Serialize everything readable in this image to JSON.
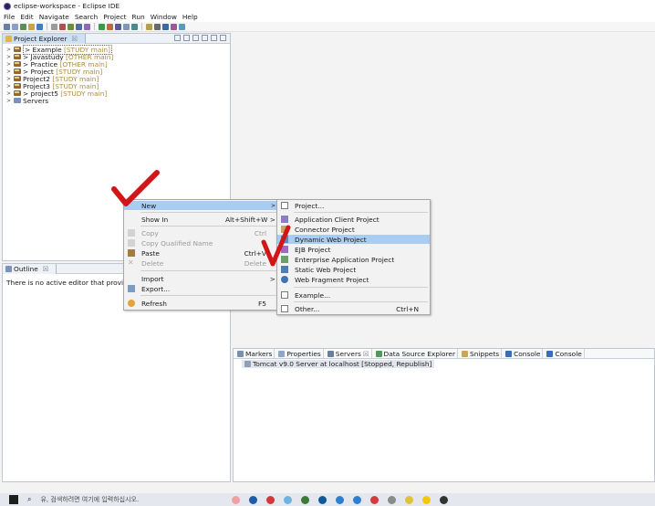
{
  "window": {
    "title": "eclipse-workspace - Eclipse IDE"
  },
  "menubar": [
    "File",
    "Edit",
    "Navigate",
    "Search",
    "Project",
    "Run",
    "Window",
    "Help"
  ],
  "project_explorer": {
    "tab_label": "Project Explorer",
    "close_glyph": "☒",
    "items": [
      {
        "prefix": "> ",
        "name": "Example",
        "tag": "[STUDY main]",
        "icon": "project-icon",
        "selected": true
      },
      {
        "prefix": "> ",
        "name": "Javastudy",
        "tag": "[OTHER main]",
        "icon": "project-icon"
      },
      {
        "prefix": "> ",
        "name": "Practice",
        "tag": "[OTHER main]",
        "icon": "project-icon"
      },
      {
        "prefix": "> ",
        "name": "Project",
        "tag": "[STUDY main]",
        "icon": "project-icon"
      },
      {
        "prefix": "",
        "name": "Project2",
        "tag": "[STUDY main]",
        "icon": "project-icon"
      },
      {
        "prefix": "",
        "name": "Project3",
        "tag": "[STUDY main]",
        "icon": "project-icon"
      },
      {
        "prefix": "> ",
        "name": "project5",
        "tag": "[STUDY main]",
        "icon": "project-icon"
      },
      {
        "prefix": "",
        "name": "Servers",
        "tag": "",
        "icon": "servers-icon"
      }
    ]
  },
  "outline": {
    "tab_label": "Outline",
    "close_glyph": "☒",
    "message": "There is no active editor that provid"
  },
  "bottom_panel": {
    "tabs": [
      "Markers",
      "Properties",
      "Servers",
      "Data Source Explorer",
      "Snippets",
      "Console",
      "Console"
    ],
    "servers_close_glyph": "☒",
    "server_row": "Tomcat v9.0 Server at localhost  [Stopped, Republish]"
  },
  "context_menu": {
    "items": [
      {
        "label": "New",
        "accel": "",
        "submenu": true,
        "highlighted": true
      },
      {
        "label": "Show In",
        "accel": "Alt+Shift+W >",
        "submenu": false
      },
      {
        "label": "Copy",
        "accel": "Ctrl",
        "disabled": true
      },
      {
        "label": "Copy Qualified Name",
        "accel": "",
        "disabled": true
      },
      {
        "label": "Paste",
        "accel": "Ctrl+V"
      },
      {
        "label": "Delete",
        "accel": "Delete",
        "disabled": true
      },
      {
        "label": "Import",
        "accel": ">"
      },
      {
        "label": "Export...",
        "accel": ""
      },
      {
        "label": "Refresh",
        "accel": "F5"
      }
    ]
  },
  "new_submenu": {
    "items": [
      {
        "label": "Project...",
        "accel": ""
      },
      {
        "label": "Application Client Project",
        "accel": ""
      },
      {
        "label": "Connector Project",
        "accel": ""
      },
      {
        "label": "Dynamic Web Project",
        "accel": "",
        "highlighted": true
      },
      {
        "label": "EJB Project",
        "accel": ""
      },
      {
        "label": "Enterprise Application Project",
        "accel": ""
      },
      {
        "label": "Static Web Project",
        "accel": ""
      },
      {
        "label": "Web Fragment Project",
        "accel": ""
      },
      {
        "label": "Example...",
        "accel": ""
      },
      {
        "label": "Other...",
        "accel": "Ctrl+N"
      }
    ]
  },
  "taskbar": {
    "search_text": "유, 검색하려면 여기에 입력하십시오."
  },
  "colors": {
    "highlight": "#a9cdf2",
    "check_mark": "#d01616",
    "tag_text": "#b08a3e",
    "tab_active": "#cfe0f3"
  }
}
